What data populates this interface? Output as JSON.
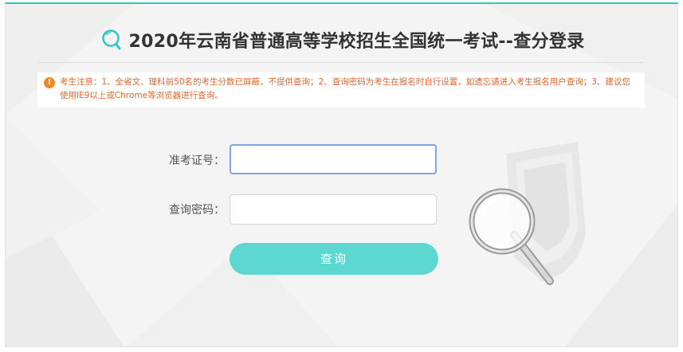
{
  "header": {
    "title": "2020年云南省普通高等学校招生全国统一考试--查分登录",
    "logo_icon": "search-icon",
    "accent_color": "#2fc7c6"
  },
  "notice": {
    "icon": "exclamation-icon",
    "text": "考生注意：1、全省文、理科前50名的考生分数已屏蔽，不提供查询；2、查询密码为考生在报名时自行设置，如遗忘请进入考生报名用户查询；3、建议您使用IE9以上或Chrome等浏览器进行查询。",
    "color": "#e0662a"
  },
  "form": {
    "ticket_label": "准考证号：",
    "ticket_value": "",
    "password_label": "查询密码：",
    "password_value": "",
    "submit_label": "查询",
    "submit_color": "#5cd8d0"
  },
  "illustration": {
    "icon": "magnifier-document-icon"
  }
}
